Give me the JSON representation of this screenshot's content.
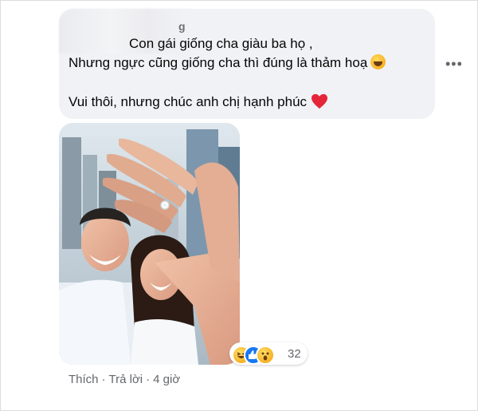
{
  "comment": {
    "author_visible_fragment": "g",
    "lines": [
      "Con gái giống cha giàu ba họ ,",
      "Nhưng ngực cũng giống cha thì đúng là thảm hoạ",
      "Vui thôi, nhưng chúc anh chị hạnh phúc"
    ],
    "line2_emoji": "rolling-on-floor-laughing-emoji",
    "line3_emoji": "red-heart-emoji",
    "more_label": "•••"
  },
  "photo": {
    "icon": "engagement-ring-photo"
  },
  "reactions": {
    "types": [
      "haha",
      "like",
      "wow"
    ],
    "count": "32"
  },
  "actions": {
    "like_label": "Thích",
    "reply_label": "Trả lời",
    "separator": "·",
    "time_label": "4 giờ"
  },
  "colors": {
    "bubble_bg": "#f0f2f5",
    "text": "#050505",
    "secondary_text": "#65676b",
    "like_blue": "#1877f2",
    "heart_red": "#e4253a"
  }
}
